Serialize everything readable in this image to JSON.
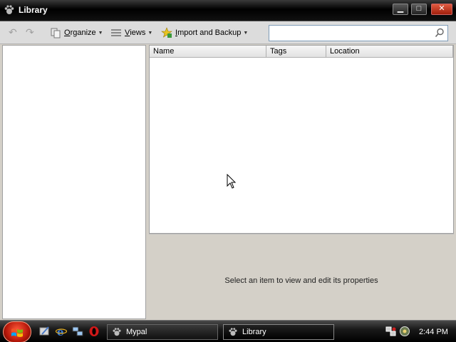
{
  "window": {
    "title": "Library",
    "app_icon": "paw-icon",
    "controls": {
      "minimize": "▁",
      "maximize": "□",
      "close": "✕"
    }
  },
  "toolbar": {
    "back_icon": "back-arrow-icon",
    "forward_icon": "forward-arrow-icon",
    "organize": {
      "prefix": "",
      "accel": "O",
      "rest": "rganize"
    },
    "views": {
      "accel": "V",
      "rest": "iews"
    },
    "import_backup": {
      "accel": "I",
      "rest": "mport and Backup"
    },
    "search": {
      "value": "",
      "placeholder": ""
    }
  },
  "list": {
    "columns": [
      "Name",
      "Tags",
      "Location"
    ],
    "rows": []
  },
  "properties": {
    "message": "Select an item to view and edit its properties"
  },
  "taskbar": {
    "tasks": [
      "Mypal",
      "Library"
    ],
    "active_task": "Library",
    "clock": "2:44 PM"
  },
  "colors": {
    "titlebar": "#000000",
    "close_button": "#c0301a",
    "window_bg": "#d4d0c8",
    "start_button": "#c8200f"
  }
}
